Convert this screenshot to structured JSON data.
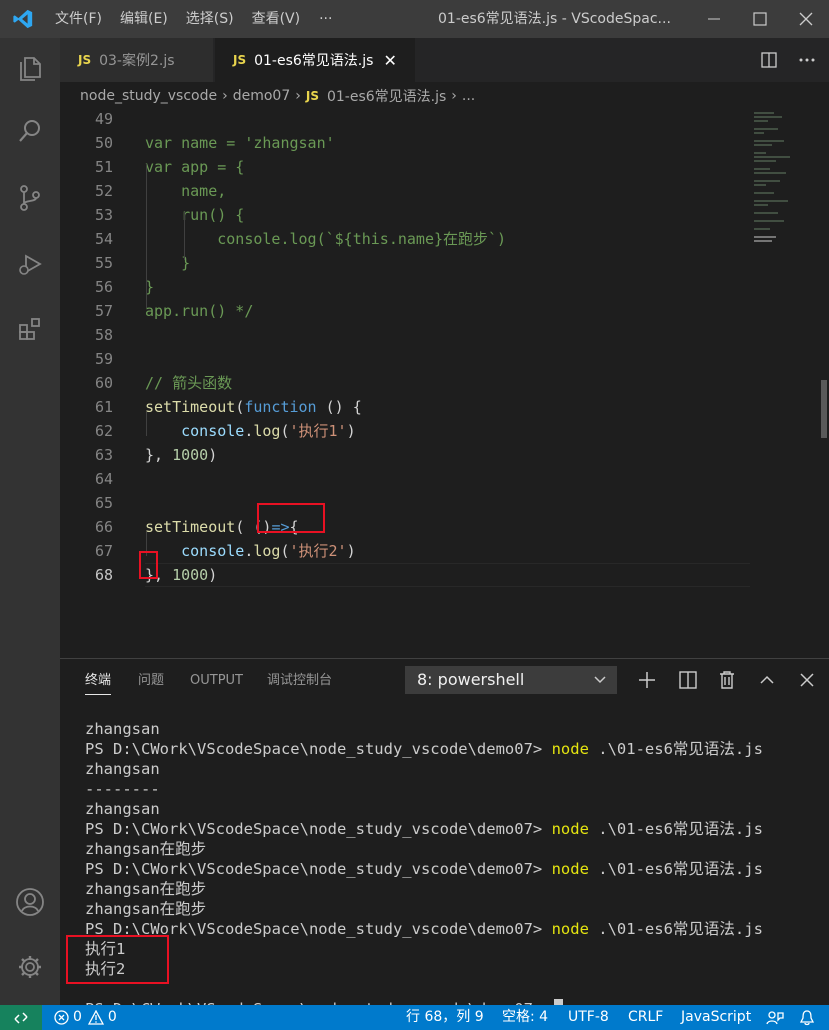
{
  "titlebar": {
    "menus": [
      "文件(F)",
      "编辑(E)",
      "选择(S)",
      "查看(V)"
    ],
    "more": "···",
    "window_title": "01-es6常见语法.js - VScodeSpac..."
  },
  "tabs": [
    {
      "badge": "JS",
      "label": "03-案例2.js",
      "active": false
    },
    {
      "badge": "JS",
      "label": "01-es6常见语法.js",
      "active": true,
      "close": "✕"
    }
  ],
  "breadcrumb": {
    "items": [
      "node_study_vscode",
      "demo07"
    ],
    "file_badge": "JS",
    "file": "01-es6常见语法.js",
    "tail": "...",
    "separator": "›"
  },
  "editor": {
    "cursor_line": "68",
    "lines": [
      {
        "n": "49",
        "tokens": []
      },
      {
        "n": "50",
        "tokens": [
          {
            "t": "var name = 'zhangsan'",
            "c": "cm"
          }
        ]
      },
      {
        "n": "51",
        "tokens": [
          {
            "t": "var app = {",
            "c": "cm"
          }
        ]
      },
      {
        "n": "52",
        "tokens": [
          {
            "t": "    name,",
            "c": "cm"
          }
        ]
      },
      {
        "n": "53",
        "tokens": [
          {
            "t": "    run() {",
            "c": "cm"
          }
        ]
      },
      {
        "n": "54",
        "tokens": [
          {
            "t": "        console.log(`${this.name}在跑步`)",
            "c": "cm"
          }
        ]
      },
      {
        "n": "55",
        "tokens": [
          {
            "t": "    }",
            "c": "cm"
          }
        ]
      },
      {
        "n": "56",
        "tokens": [
          {
            "t": "}",
            "c": "cm"
          }
        ]
      },
      {
        "n": "57",
        "tokens": [
          {
            "t": "app.run() */",
            "c": "cm"
          }
        ]
      },
      {
        "n": "58",
        "tokens": []
      },
      {
        "n": "59",
        "tokens": []
      },
      {
        "n": "60",
        "tokens": [
          {
            "t": "// 箭头函数",
            "c": "cm"
          }
        ]
      },
      {
        "n": "61",
        "tokens": [
          {
            "t": "setTimeout",
            "c": "fn"
          },
          {
            "t": "(",
            "c": "pl"
          },
          {
            "t": "function",
            "c": "kw"
          },
          {
            "t": " () {",
            "c": "pl"
          }
        ]
      },
      {
        "n": "62",
        "tokens": [
          {
            "t": "    ",
            "c": "pl"
          },
          {
            "t": "console",
            "c": "vr"
          },
          {
            "t": ".",
            "c": "pl"
          },
          {
            "t": "log",
            "c": "fn"
          },
          {
            "t": "(",
            "c": "pl"
          },
          {
            "t": "'执行1'",
            "c": "str"
          },
          {
            "t": ")",
            "c": "pl"
          }
        ]
      },
      {
        "n": "63",
        "tokens": [
          {
            "t": "}, ",
            "c": "pl"
          },
          {
            "t": "1000",
            "c": "num"
          },
          {
            "t": ")",
            "c": "pl"
          }
        ]
      },
      {
        "n": "64",
        "tokens": []
      },
      {
        "n": "65",
        "tokens": []
      },
      {
        "n": "66",
        "tokens": [
          {
            "t": "setTimeout",
            "c": "fn"
          },
          {
            "t": "( ()",
            "c": "pl"
          },
          {
            "t": "=>",
            "c": "kw"
          },
          {
            "t": "{",
            "c": "pl"
          }
        ]
      },
      {
        "n": "67",
        "tokens": [
          {
            "t": "    ",
            "c": "pl"
          },
          {
            "t": "console",
            "c": "vr"
          },
          {
            "t": ".",
            "c": "pl"
          },
          {
            "t": "log",
            "c": "fn"
          },
          {
            "t": "(",
            "c": "pl"
          },
          {
            "t": "'执行2'",
            "c": "str"
          },
          {
            "t": ")",
            "c": "pl"
          }
        ]
      },
      {
        "n": "68",
        "tokens": [
          {
            "t": "}, ",
            "c": "pl"
          },
          {
            "t": "1000",
            "c": "num"
          },
          {
            "t": ")",
            "c": "pl"
          }
        ]
      }
    ]
  },
  "panel": {
    "tabs": [
      "终端",
      "问题",
      "OUTPUT",
      "调试控制台"
    ],
    "terminal_select": "8: powershell",
    "terminal_lines": [
      {
        "text": "zhangsan"
      },
      {
        "text": "PS D:\\CWork\\VScodeSpace\\node_study_vscode\\demo07> ",
        "cmd": "node",
        "args": " .\\01-es6常见语法.js"
      },
      {
        "text": "zhangsan"
      },
      {
        "text": "--------"
      },
      {
        "text": "zhangsan"
      },
      {
        "text": "PS D:\\CWork\\VScodeSpace\\node_study_vscode\\demo07> ",
        "cmd": "node",
        "args": " .\\01-es6常见语法.js"
      },
      {
        "text": "zhangsan在跑步"
      },
      {
        "text": "PS D:\\CWork\\VScodeSpace\\node_study_vscode\\demo07> ",
        "cmd": "node",
        "args": " .\\01-es6常见语法.js"
      },
      {
        "text": "zhangsan在跑步"
      },
      {
        "text": "zhangsan在跑步"
      },
      {
        "text": "PS D:\\CWork\\VScodeSpace\\node_study_vscode\\demo07> ",
        "cmd": "node",
        "args": " .\\01-es6常见语法.js"
      },
      {
        "text": "执行1"
      },
      {
        "text": "执行2"
      },
      {
        "text": ""
      },
      {
        "text": "PS D:\\CWork\\VScodeSpace\\node_study_vscode\\demo07> ",
        "cursor": true
      }
    ]
  },
  "statusbar": {
    "errors": "0",
    "warnings": "0",
    "position": "行 68，列 9",
    "spaces": "空格: 4",
    "encoding": "UTF-8",
    "eol": "CRLF",
    "language": "JavaScript"
  },
  "colors": {
    "titlebar": "#3c3c3c",
    "activitybar": "#333333",
    "editor_bg": "#1e1e1e",
    "statusbar": "#007acc",
    "remote": "#16825d",
    "highlight_box": "#e81123"
  }
}
